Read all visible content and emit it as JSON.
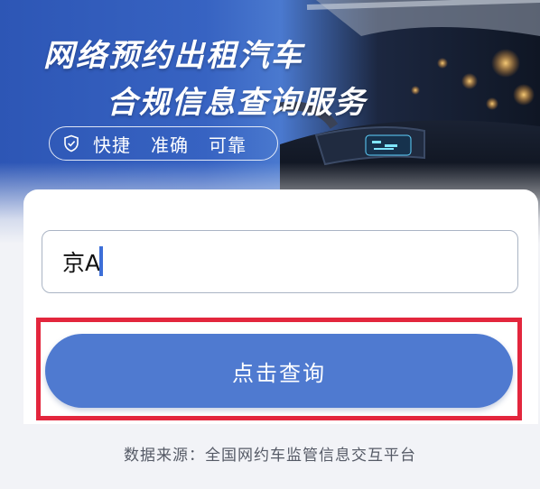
{
  "hero": {
    "title_line1": "网络预约出租汽车",
    "title_line2": "合规信息查询服务",
    "shield_icon": "shield-check-icon",
    "tags": [
      "快捷",
      "准确",
      "可靠"
    ]
  },
  "form": {
    "plate_value": "京A",
    "query_button_label": "点击查询"
  },
  "footer": {
    "source": "数据来源：全国网约车监管信息交互平台"
  },
  "colors": {
    "primary": "#4f7ad0",
    "highlight": "#e3263d",
    "hero_blue": "#2d56b5"
  }
}
